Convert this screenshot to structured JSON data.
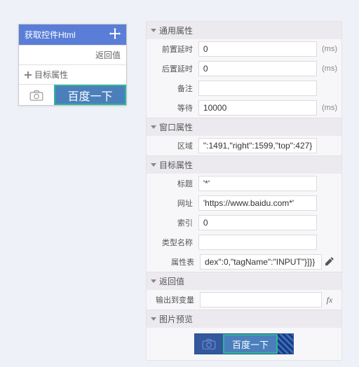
{
  "node": {
    "title": "获取控件Html",
    "return_label": "返回值",
    "target_label": "目标属性",
    "button_text": "百度一下"
  },
  "sections": {
    "general": {
      "title": "通用属性",
      "pre_delay_label": "前置延时",
      "pre_delay_value": "0",
      "pre_delay_unit": "(ms)",
      "post_delay_label": "后置延时",
      "post_delay_value": "0",
      "post_delay_unit": "(ms)",
      "remark_label": "备注",
      "remark_value": "",
      "wait_label": "等待",
      "wait_value": "10000",
      "wait_unit": "(ms)"
    },
    "window": {
      "title": "窗口属性",
      "region_label": "区域",
      "region_value": "\":1491,\"right\":1599,\"top\":427}"
    },
    "target": {
      "title": "目标属性",
      "title_prop_label": "标题",
      "title_prop_value": "'*'",
      "url_label": "网址",
      "url_value": "'https://www.baidu.com*'",
      "index_label": "索引",
      "index_value": "0",
      "type_label": "类型名称",
      "type_value": "",
      "attrs_label": "属性表",
      "attrs_value": "dex\":0,\"tagName\":\"INPUT\"}]}}"
    },
    "return": {
      "title": "返回值",
      "output_label": "输出到变量",
      "output_value": ""
    },
    "preview": {
      "title": "图片预览",
      "button_text": "百度一下"
    }
  }
}
